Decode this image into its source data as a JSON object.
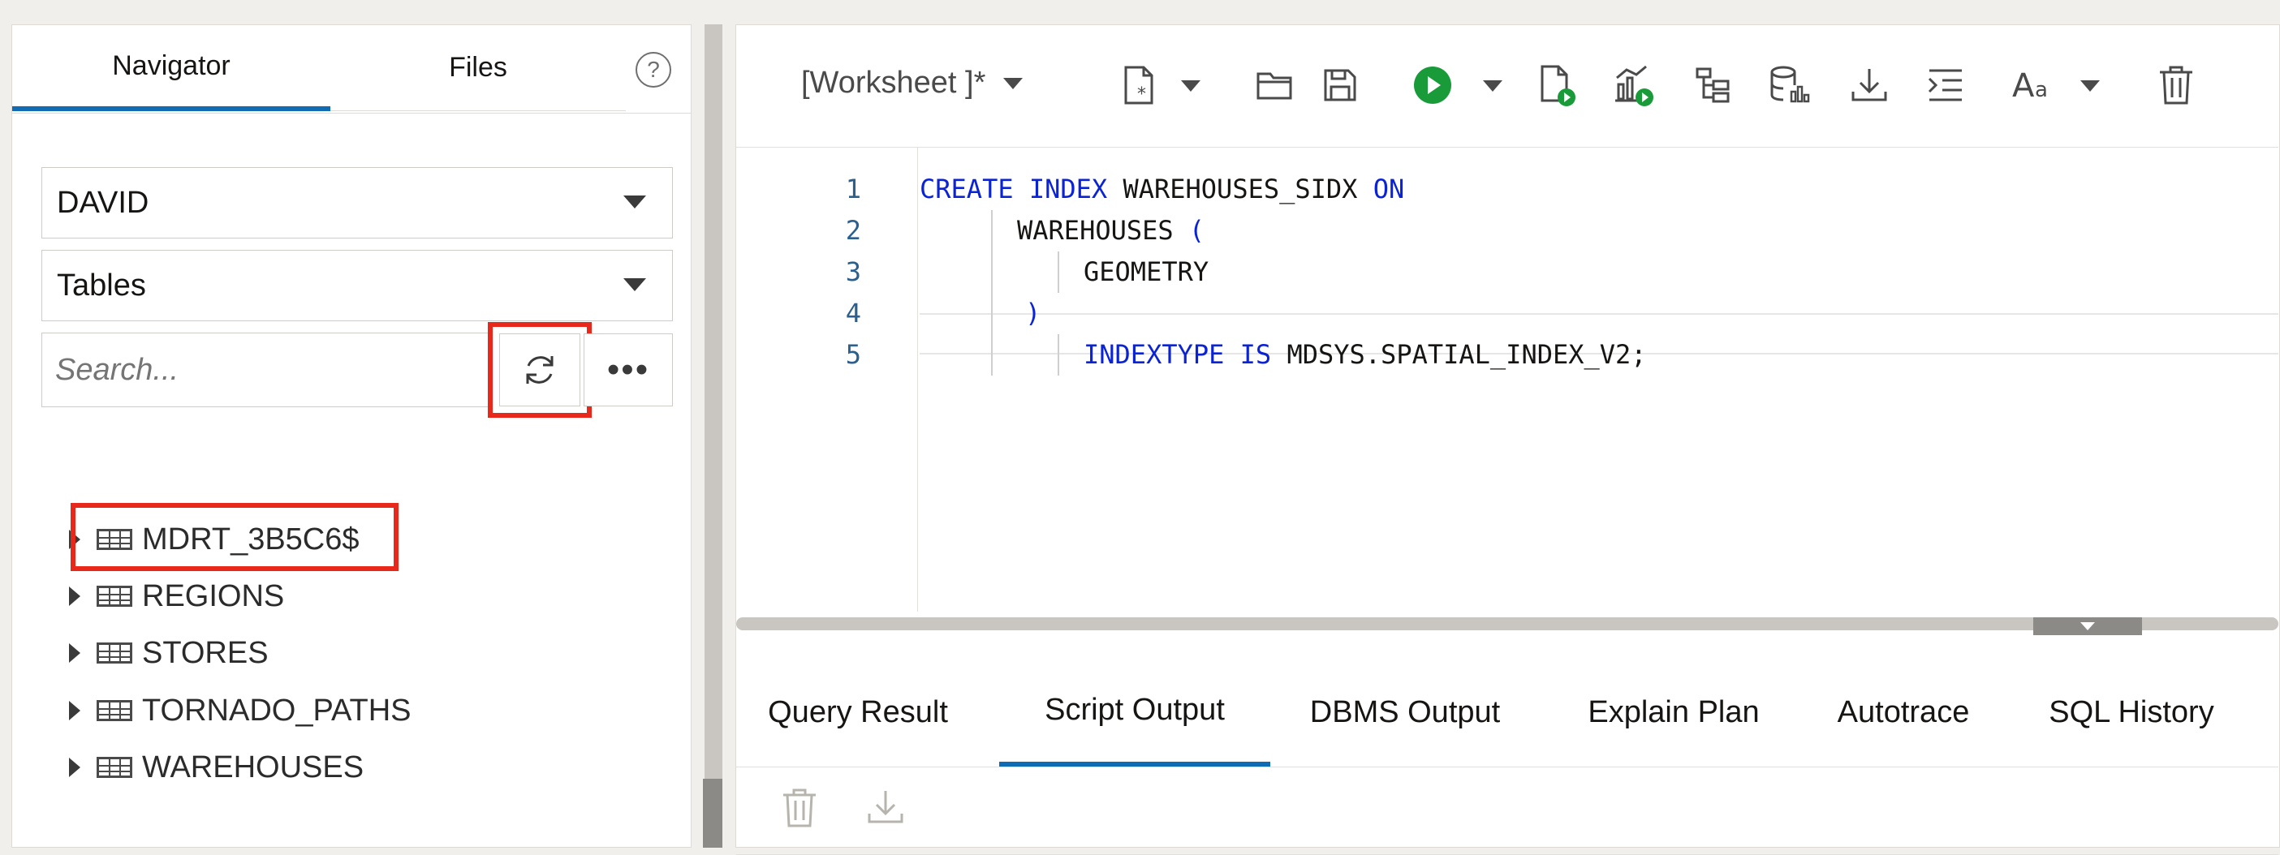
{
  "navigator": {
    "tabs": [
      {
        "label": "Navigator"
      },
      {
        "label": "Files"
      }
    ],
    "help_glyph": "?",
    "schema_value": "DAVID",
    "object_type_value": "Tables",
    "search_placeholder": "Search...",
    "tree_items": [
      {
        "label": "MDRT_3B5C6$"
      },
      {
        "label": "REGIONS"
      },
      {
        "label": "STORES"
      },
      {
        "label": "TORNADO_PATHS"
      },
      {
        "label": "WAREHOUSES"
      }
    ]
  },
  "worksheet": {
    "title": "[Worksheet ]*",
    "toolbar_icons": [
      "new-file-icon",
      "open-folder-icon",
      "save-icon",
      "run-statement-icon",
      "run-script-icon",
      "autotrace-icon",
      "explain-plan-icon",
      "database-stats-icon",
      "download-icon",
      "format-icon",
      "font-size-icon",
      "trash-icon"
    ],
    "line_numbers": [
      "1",
      "2",
      "3",
      "4",
      "5"
    ],
    "code": {
      "l1_kw1": "CREATE",
      "l1_kw2": "INDEX",
      "l1_name": "WAREHOUSES_SIDX",
      "l1_kw3": "ON",
      "l2_name": "WAREHOUSES",
      "l2_paren": "(",
      "l3_name": "GEOMETRY",
      "l4_paren": ")",
      "l5_kw1": "INDEXTYPE",
      "l5_kw2": "IS",
      "l5_name": "MDSYS.SPATIAL_INDEX_V2;"
    }
  },
  "output": {
    "tabs": [
      {
        "label": "Query Result"
      },
      {
        "label": "Script Output"
      },
      {
        "label": "DBMS Output"
      },
      {
        "label": "Explain Plan"
      },
      {
        "label": "Autotrace"
      },
      {
        "label": "SQL History"
      }
    ],
    "active_tab": "Script Output"
  },
  "colors": {
    "accent": "#0f6bb3",
    "highlight": "#e8281a",
    "run": "#1a9b3a",
    "keyword": "#0b23d6"
  }
}
